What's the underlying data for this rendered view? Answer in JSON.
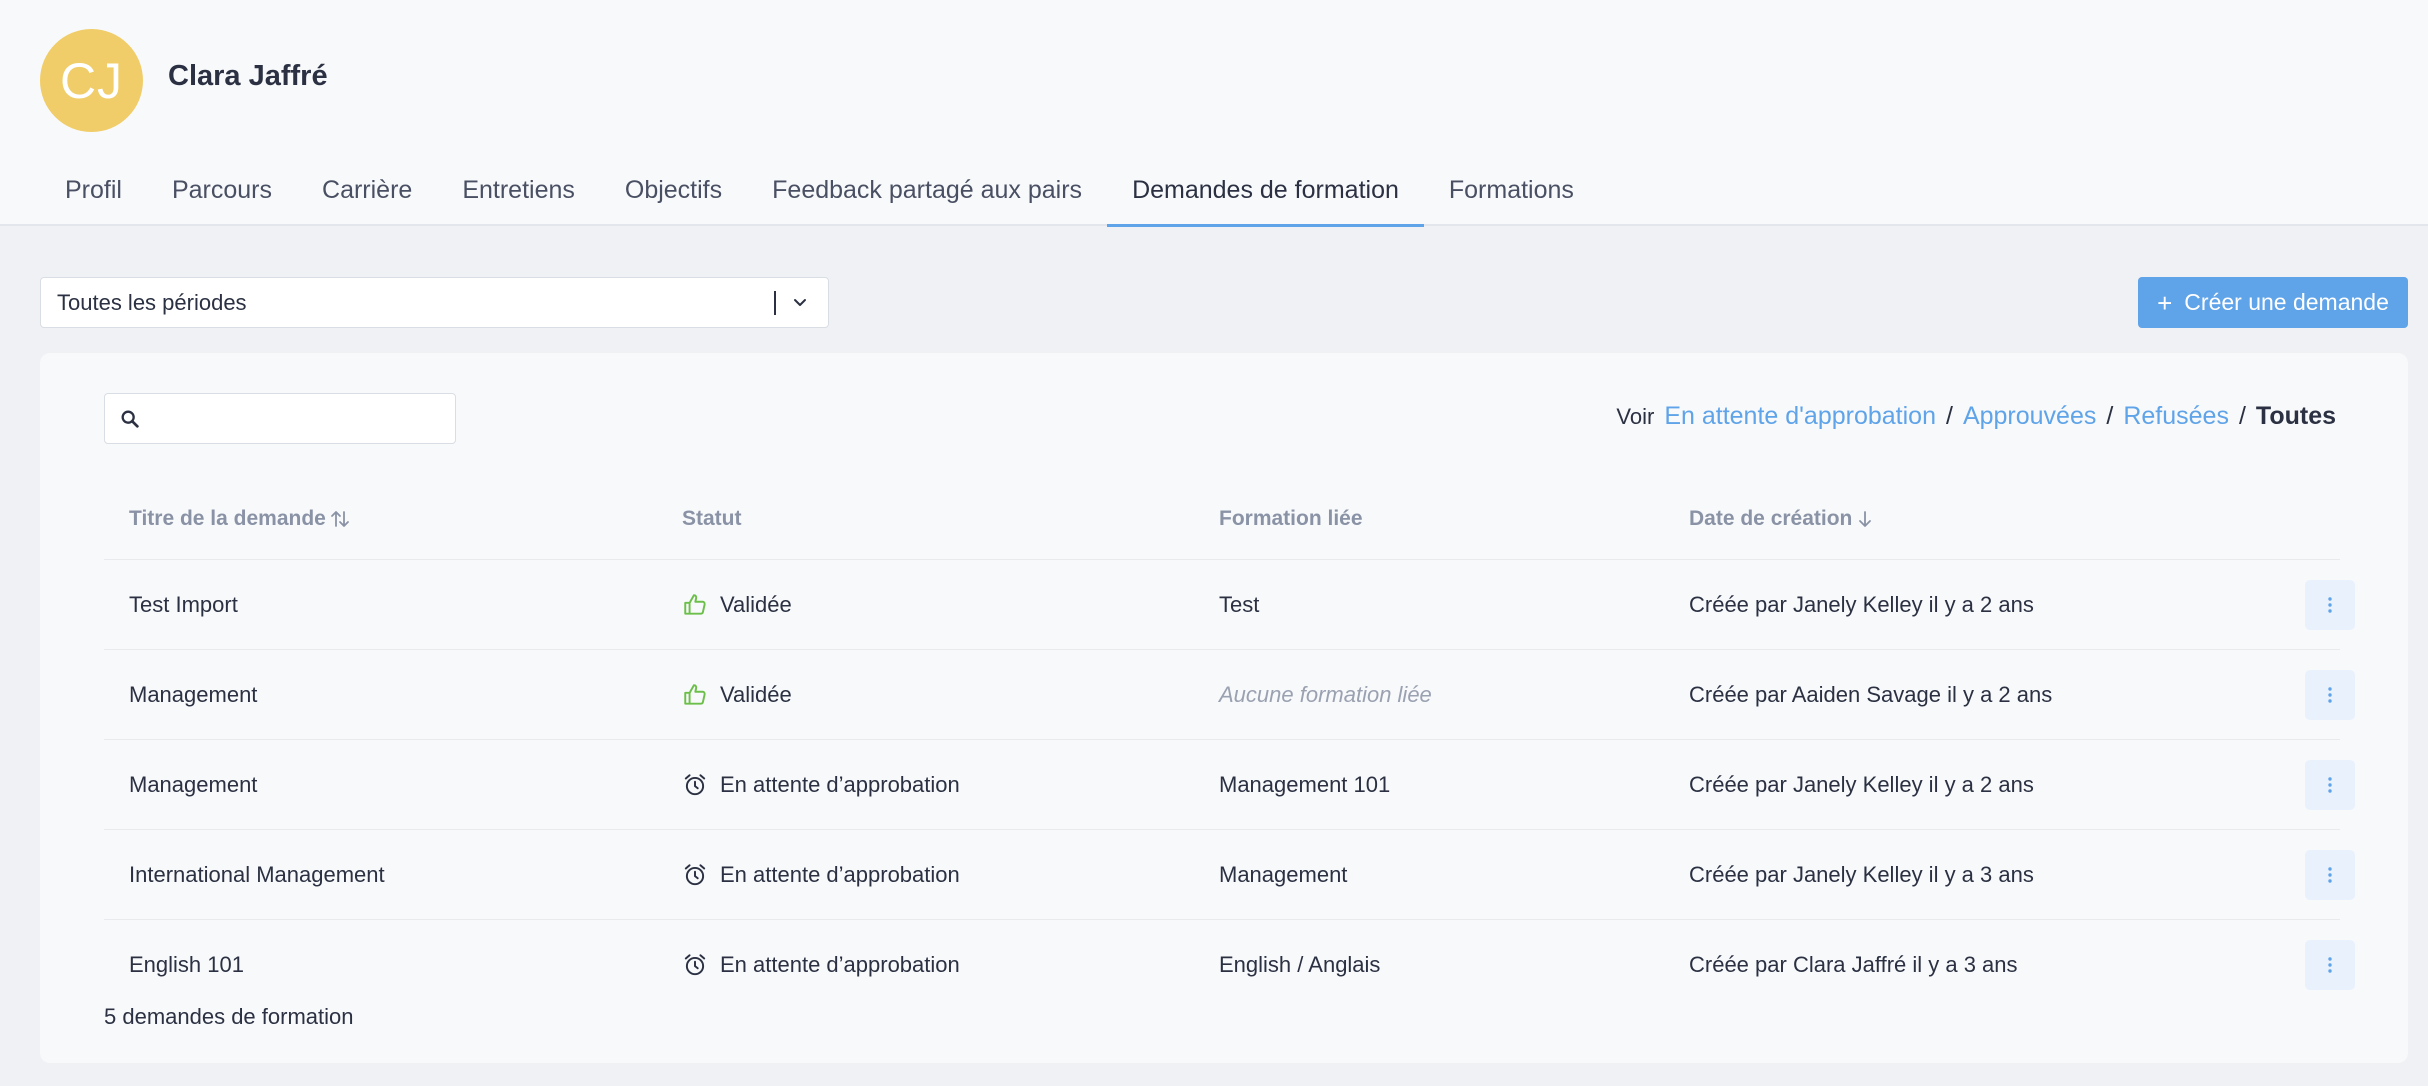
{
  "user": {
    "initials": "CJ",
    "name": "Clara Jaffré",
    "avatar_color": "#f0cd68"
  },
  "tabs": [
    {
      "label": "Profil"
    },
    {
      "label": "Parcours"
    },
    {
      "label": "Carrière"
    },
    {
      "label": "Entretiens"
    },
    {
      "label": "Objectifs"
    },
    {
      "label": "Feedback partagé aux pairs"
    },
    {
      "label": "Demandes de formation",
      "active": true
    },
    {
      "label": "Formations"
    }
  ],
  "period_select": {
    "value": "Toutes les périodes"
  },
  "create_button": {
    "label": "Créer une demande"
  },
  "search": {
    "placeholder": ""
  },
  "filters": {
    "prefix": "Voir",
    "pending": "En attente d'approbation",
    "approved": "Approuvées",
    "refused": "Refusées",
    "all": "Toutes",
    "sep": "/"
  },
  "table": {
    "headers": {
      "title": "Titre de la demande",
      "status": "Statut",
      "training": "Formation liée",
      "date": "Date de création"
    },
    "rows": [
      {
        "title": "Test Import",
        "status": "Validée",
        "status_icon": "thumbs-up-icon",
        "training": "Test",
        "created": "Créée par Janely Kelley il y a 2 ans"
      },
      {
        "title": "Management",
        "status": "Validée",
        "status_icon": "thumbs-up-icon",
        "training": "Aucune formation liée",
        "training_empty": true,
        "created": "Créée par Aaiden Savage il y a 2 ans"
      },
      {
        "title": "Management",
        "status": "En attente d’approbation",
        "status_icon": "alarm-clock-icon",
        "training": "Management 101",
        "created": "Créée par Janely Kelley il y a 2 ans"
      },
      {
        "title": "International Management",
        "status": "En attente d’approbation",
        "status_icon": "alarm-clock-icon",
        "training": "Management",
        "created": "Créée par Janely Kelley il y a 3 ans"
      },
      {
        "title": "English 101",
        "status": "En attente d’approbation",
        "status_icon": "alarm-clock-icon",
        "training": "English / Anglais",
        "created": "Créée par Clara Jaffré il y a 3 ans"
      }
    ],
    "count_label": "5 demandes de formation"
  },
  "colors": {
    "accent": "#5fa3e8",
    "validated": "#6cc04a",
    "text": "#2b3142"
  }
}
